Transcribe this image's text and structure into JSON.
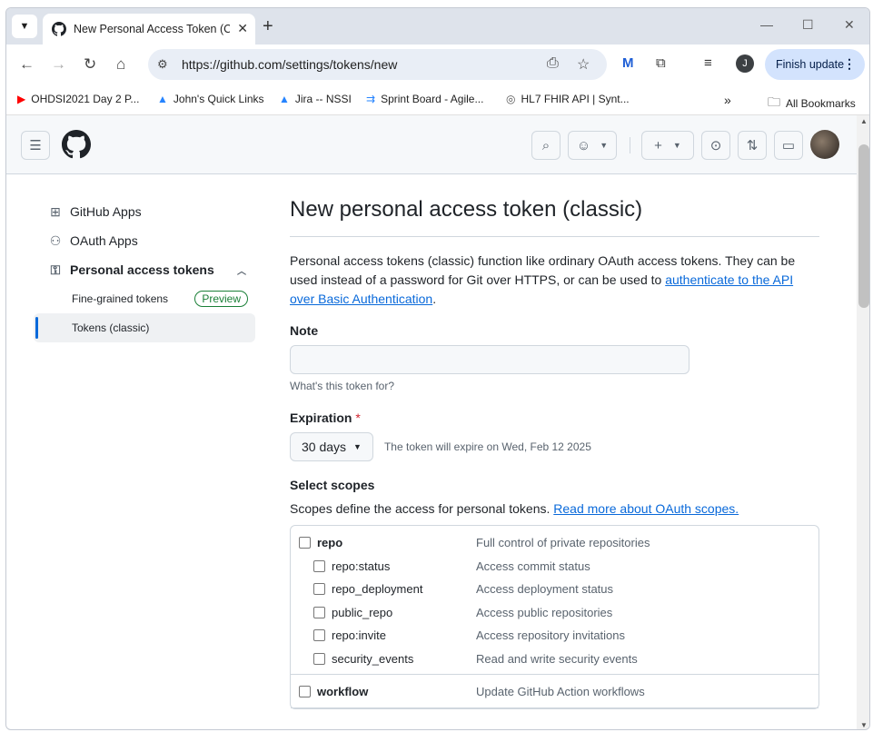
{
  "browser": {
    "tab_title": "New Personal Access Token (Cla",
    "url": "https://github.com/settings/tokens/new",
    "profile_initial": "J",
    "finish_update_label": "Finish update",
    "bookmarks": [
      {
        "label": "OHDSI2021 Day 2 P...",
        "icon": "youtube-icon",
        "color": "#ff0000"
      },
      {
        "label": "John's Quick Links",
        "icon": "jira-icon",
        "color": "#2684ff"
      },
      {
        "label": "Jira -- NSSI",
        "icon": "jira-icon",
        "color": "#2684ff"
      },
      {
        "label": "Sprint Board - Agile...",
        "icon": "agile-icon",
        "color": "#2684ff"
      },
      {
        "label": "HL7 FHIR API | Synt...",
        "icon": "fingerprint-icon",
        "color": "#555555"
      }
    ],
    "all_bookmarks_label": "All Bookmarks"
  },
  "sidebar": {
    "items": [
      {
        "label": "GitHub Apps",
        "icon": "grid-icon"
      },
      {
        "label": "OAuth Apps",
        "icon": "person-icon"
      },
      {
        "label": "Personal access tokens",
        "icon": "key-icon"
      }
    ],
    "sub_items": [
      {
        "label": "Fine-grained tokens",
        "badge": "Preview"
      },
      {
        "label": "Tokens (classic)"
      }
    ]
  },
  "main": {
    "title": "New personal access token (classic)",
    "intro_text": "Personal access tokens (classic) function like ordinary OAuth access tokens. They can be used instead of a password for Git over HTTPS, or can be used to ",
    "intro_link": "authenticate to the API over Basic Authentication",
    "intro_end": ".",
    "note_label": "Note",
    "note_value": "",
    "note_hint": "What's this token for?",
    "expiration_label": "Expiration",
    "required_mark": "*",
    "expiration_value": "30 days",
    "expiration_text": "The token will expire on Wed, Feb 12 2025",
    "scopes_label": "Select scopes",
    "scopes_desc": "Scopes define the access for personal tokens. ",
    "scopes_link": "Read more about OAuth scopes.",
    "scopes": {
      "repo": {
        "name": "repo",
        "desc": "Full control of private repositories"
      },
      "repo_children": [
        {
          "name": "repo:status",
          "desc": "Access commit status"
        },
        {
          "name": "repo_deployment",
          "desc": "Access deployment status"
        },
        {
          "name": "public_repo",
          "desc": "Access public repositories"
        },
        {
          "name": "repo:invite",
          "desc": "Access repository invitations"
        },
        {
          "name": "security_events",
          "desc": "Read and write security events"
        }
      ],
      "workflow": {
        "name": "workflow",
        "desc": "Update GitHub Action workflows"
      }
    }
  },
  "colors": {
    "accent": "#0969da",
    "success": "#1a7f37",
    "danger": "#d1242f"
  }
}
